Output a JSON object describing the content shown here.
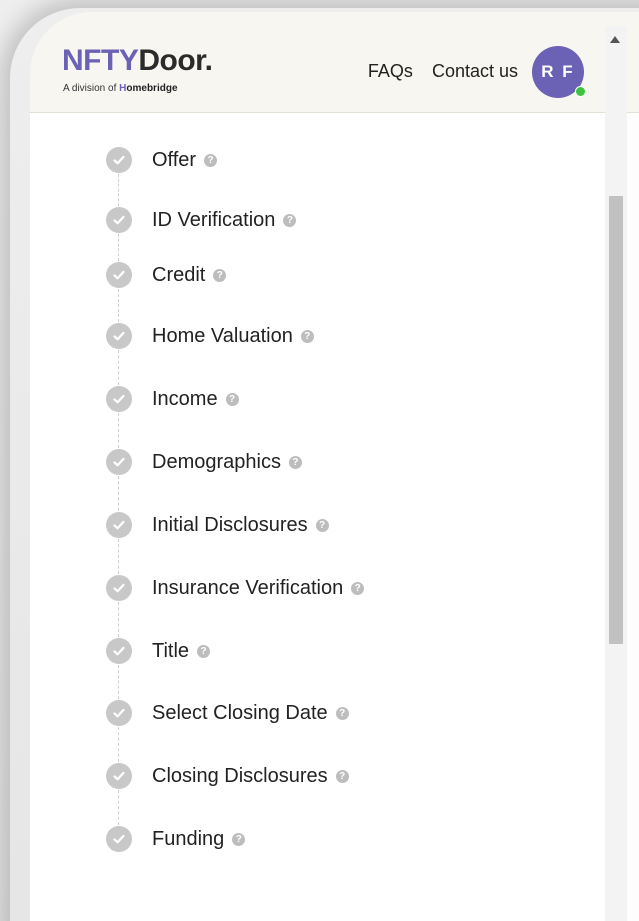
{
  "header": {
    "logo_part_1": "NFTY",
    "logo_part_2": "Door.",
    "tagline_prefix": "A division of ",
    "tagline_brand_accent": "H",
    "tagline_brand_rest": "omebridge",
    "nav": {
      "faqs": "FAQs",
      "contact": "Contact us"
    },
    "avatar_initials": "R F",
    "avatar_status": "online"
  },
  "steps": [
    {
      "label": "Offer",
      "status": "complete"
    },
    {
      "label": "ID Verification",
      "status": "complete"
    },
    {
      "label": "Credit",
      "status": "complete"
    },
    {
      "label": "Home Valuation",
      "status": "complete"
    },
    {
      "label": "Income",
      "status": "complete"
    },
    {
      "label": "Demographics",
      "status": "complete"
    },
    {
      "label": "Initial Disclosures",
      "status": "complete"
    },
    {
      "label": "Insurance Verification",
      "status": "complete"
    },
    {
      "label": "Title",
      "status": "complete"
    },
    {
      "label": "Select Closing Date",
      "status": "complete"
    },
    {
      "label": "Closing Disclosures",
      "status": "complete"
    },
    {
      "label": "Funding",
      "status": "complete"
    }
  ],
  "help_glyph": "?",
  "colors": {
    "brand": "#6b61b5",
    "check_complete": "#c8c8c8",
    "online": "#3cc43c"
  }
}
